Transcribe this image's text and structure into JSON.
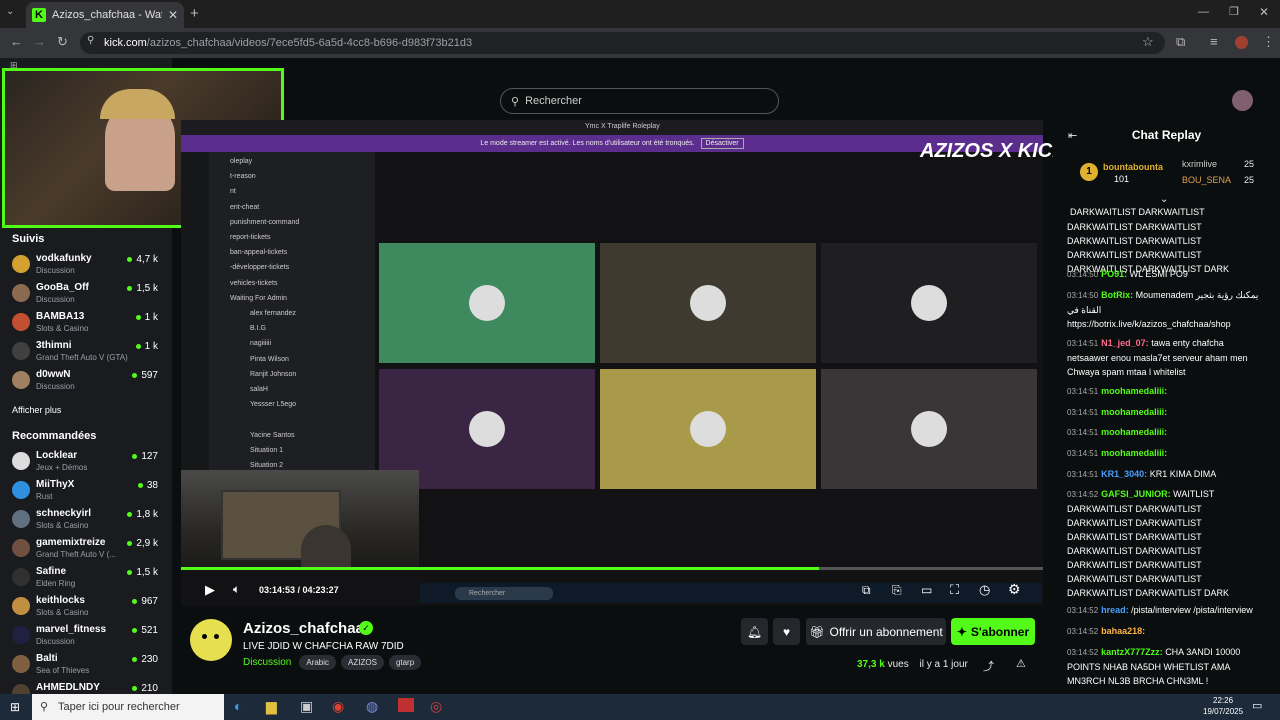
{
  "browser": {
    "tab_title": "Azizos_chafchaa - Watch the V",
    "url_domain": "kick.com",
    "url_path": "/azizos_chafchaa/videos/7ece5fd5-6a5d-4cc8-b696-d983f73b21d3"
  },
  "header": {
    "search_placeholder": "Rechercher"
  },
  "sidebar": {
    "following_title": "Suivis",
    "following": [
      {
        "name": "vodkafunky",
        "category": "Discussion",
        "viewers": "4,7 k",
        "color": "#d4a030"
      },
      {
        "name": "GooBa_Off",
        "category": "Discussion",
        "viewers": "1,5 k",
        "color": "#8a6a50"
      },
      {
        "name": "BAMBA13",
        "category": "Slots & Casino",
        "viewers": "1 k",
        "color": "#c05030"
      },
      {
        "name": "3thimni",
        "category": "Grand Theft Auto V (GTA)",
        "viewers": "1 k",
        "color": "#404040"
      },
      {
        "name": "d0wwN",
        "category": "Discussion",
        "viewers": "597",
        "color": "#a08060"
      }
    ],
    "show_more": "Afficher plus",
    "recommended_title": "Recommandées",
    "recommended": [
      {
        "name": "Locklear",
        "category": "Jeux + Démos",
        "viewers": "127",
        "color": "#dddddd"
      },
      {
        "name": "MiiThyX",
        "category": "Rust",
        "viewers": "38",
        "color": "#3090e0"
      },
      {
        "name": "schneckyirl",
        "category": "Slots & Casino",
        "viewers": "1,8 k",
        "color": "#607080"
      },
      {
        "name": "gamemixtreize",
        "category": "Grand Theft Auto V (...",
        "viewers": "2,9 k",
        "color": "#705040"
      },
      {
        "name": "Safine",
        "category": "Elden Ring",
        "viewers": "1,5 k",
        "color": "#303030"
      },
      {
        "name": "keithlocks",
        "category": "Slots & Casino",
        "viewers": "967",
        "color": "#c09040"
      },
      {
        "name": "marvel_fitness",
        "category": "Discussion",
        "viewers": "521",
        "color": "#202040"
      },
      {
        "name": "Balti",
        "category": "Sea of Thieves",
        "viewers": "230",
        "color": "#806040"
      },
      {
        "name": "AHMEDLNDY",
        "category": "",
        "viewers": "210",
        "color": "#504030"
      }
    ]
  },
  "video": {
    "window_title": "Ymc X Traplife Roleplay",
    "notice": "Le mode streamer est activé. Les noms d'utilisateur ont été tronqués.",
    "notice_button": "Désactiver",
    "overlay_brand": "AZIZOS X KICK",
    "discord_channels": [
      "oleplay",
      "t-reason",
      "nt",
      "ent-cheat",
      "punishment-command",
      "report-tickets",
      "ban-appeal-tickets",
      "-développer-tickets",
      "vehicles-tickets",
      "Waiting For Admin",
      "alex fernandez",
      "B.I.G",
      "nagiiiiii",
      "Pinta Wilson",
      "Ranjit Johnson",
      "salaH",
      "Yessser L5ego",
      "",
      "Yacine Santos",
      "Situation 1",
      "Situation 2"
    ],
    "tile_colors": [
      "#3e8a5e",
      "#3f3a2f",
      "#1f1f22",
      "#3a2545",
      "#a89a48",
      "#3a3536"
    ],
    "current_time": "03:14:53",
    "total_time": "04:23:27",
    "progress": 0.74,
    "taskbar_search": "Rechercher"
  },
  "channel": {
    "name": "Azizos_chafchaa",
    "title": "LIVE JDID W CHAFCHA RAW 7DID",
    "category": "Discussion",
    "tags": [
      "Arabic",
      "AZIZOS",
      "gtarp"
    ],
    "subscribe_gift": "Offrir un abonnement",
    "subscribe": "S'abonner",
    "views": "37,3 k",
    "views_label": "vues",
    "age": "il y a 1 jour"
  },
  "chat": {
    "title": "Chat Replay",
    "top": [
      {
        "rank": "1",
        "name": "bountabounta",
        "count": "101"
      },
      {
        "name": "kxrimlive",
        "count": "25"
      },
      {
        "name": "BOU_SENA",
        "count": "25"
      }
    ],
    "messages": [
      {
        "time": "",
        "user": "",
        "color": "#fff",
        "text": "DARKWAITLIST DARKWAITLIST DARKWAITLIST DARKWAITLIST DARKWAITLIST DARKWAITLIST DARKWAITLIST DARKWAITLIST DARKWAITLIST DARKWAITLIST DARK"
      },
      {
        "time": "03:14:50",
        "user": "PO91:",
        "color": "#53fc18",
        "text": "WL ESMI PO9"
      },
      {
        "time": "03:14:50",
        "user": "BotRix:",
        "color": "#53fc18",
        "text": "Moumenadem يمكنك رؤية بثجير القناة في https://botrix.live/k/azizos_chafchaa/shop"
      },
      {
        "time": "03:14:51",
        "user": "N1_jed_07:",
        "color": "#ff6b8a",
        "text": "tawa enty chafcha netsaawer enou masla7et serveur aham men Chwaya spam mtaa l whitelist"
      },
      {
        "time": "03:14:51",
        "user": "moohamedaliii:",
        "color": "#53fc18",
        "text": ""
      },
      {
        "time": "03:14:51",
        "user": "moohamedaliii:",
        "color": "#53fc18",
        "text": ""
      },
      {
        "time": "03:14:51",
        "user": "moohamedaliii:",
        "color": "#53fc18",
        "text": ""
      },
      {
        "time": "03:14:51",
        "user": "moohamedaliii:",
        "color": "#53fc18",
        "text": ""
      },
      {
        "time": "03:14:51",
        "user": "KR1_3040:",
        "color": "#4a9fff",
        "text": "KR1 KIMA DIMA"
      },
      {
        "time": "03:14:52",
        "user": "GAFSI_JUNIOR:",
        "color": "#53fc18",
        "text": "WAITLIST DARKWAITLIST DARKWAITLIST DARKWAITLIST DARKWAITLIST DARKWAITLIST DARKWAITLIST DARKWAITLIST DARKWAITLIST DARKWAITLIST DARKWAITLIST DARKWAITLIST DARKWAITLIST DARKWAITLIST DARKWAITLIST DARK"
      },
      {
        "time": "03:14:52",
        "user": "hread:",
        "color": "#4a9fff",
        "text": "/pista/interview /pista/interview"
      },
      {
        "time": "03:14:52",
        "user": "bahaa218:",
        "color": "#ffb347",
        "text": ""
      },
      {
        "time": "03:14:52",
        "user": "kantzX777Zzz:",
        "color": "#53fc18",
        "text": "CHA 3ANDI 10000 POINTS NHAB NA5DH WHETLIST AMA MN3RCH NL3B BRCHA CHN3ML !"
      }
    ]
  },
  "taskbar": {
    "search": "Taper ici pour rechercher",
    "time": "22:26",
    "date": "19/07/2025"
  }
}
